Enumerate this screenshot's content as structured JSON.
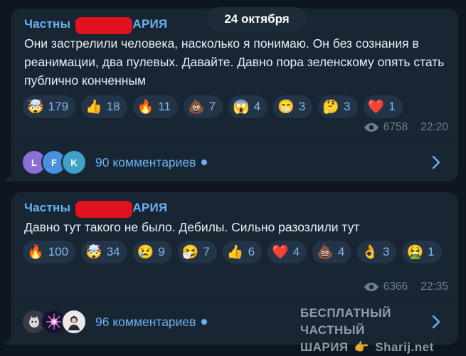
{
  "date_pill": "24 октября",
  "accent_color": "#6ab3f3",
  "redaction_color": "#e0121e",
  "messages": [
    {
      "author_prefix": "Частны",
      "author_suffix": "ШАРИЯ",
      "text": "Они застрелили человека, насколько я понимаю. Он без сознания в реанимации, два пулевых. Давайте. Давно пора зеленскому опять стать публично конченным",
      "reactions": [
        {
          "emoji": "🤯",
          "count": "179"
        },
        {
          "emoji": "👍",
          "count": "18"
        },
        {
          "emoji": "🔥",
          "count": "11"
        },
        {
          "emoji": "💩",
          "count": "7"
        },
        {
          "emoji": "😱",
          "count": "4"
        },
        {
          "emoji": "😁",
          "count": "3"
        },
        {
          "emoji": "🤔",
          "count": "3"
        },
        {
          "emoji": "❤️",
          "count": "1"
        }
      ],
      "views": "6758",
      "time": "22:20",
      "comments_label": "90 комментариев",
      "avatars": [
        {
          "letter": "L",
          "color": "#8a6fd6"
        },
        {
          "letter": "F",
          "color": "#4a8fe0"
        },
        {
          "letter": "K",
          "color": "#3fa0c8"
        }
      ]
    },
    {
      "author_prefix": "Частны",
      "author_suffix": "ШАРИЯ",
      "text": "Давно тут такого не было. Дебилы. Сильно разозлили тут",
      "reactions": [
        {
          "emoji": "🔥",
          "count": "100"
        },
        {
          "emoji": "🤯",
          "count": "34"
        },
        {
          "emoji": "😢",
          "count": "9"
        },
        {
          "emoji": "🤧",
          "count": "7"
        },
        {
          "emoji": "👍",
          "count": "6"
        },
        {
          "emoji": "❤️",
          "count": "4"
        },
        {
          "emoji": "💩",
          "count": "4"
        },
        {
          "emoji": "👌",
          "count": "3"
        },
        {
          "emoji": "🤮",
          "count": "1"
        }
      ],
      "views": "6366",
      "time": "22:35",
      "comments_label": "96 комментариев"
    }
  ],
  "watermark": {
    "line1": "БЕСПЛАТНЫЙ ЧАСТНЫЙ",
    "line2_left": "ШАРИЯ",
    "line2_right": "Sharij.net"
  }
}
